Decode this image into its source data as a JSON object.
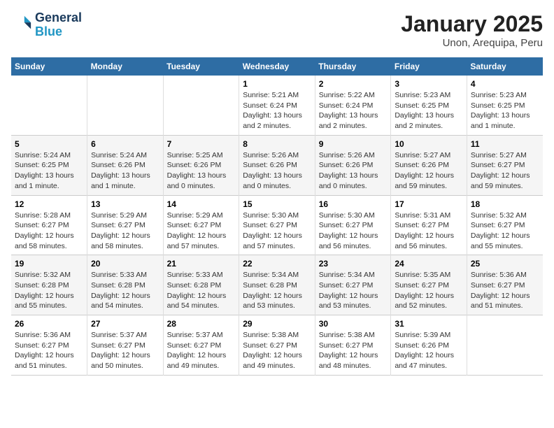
{
  "header": {
    "logo_line1": "General",
    "logo_line2": "Blue",
    "title": "January 2025",
    "subtitle": "Unon, Arequipa, Peru"
  },
  "calendar": {
    "days_of_week": [
      "Sunday",
      "Monday",
      "Tuesday",
      "Wednesday",
      "Thursday",
      "Friday",
      "Saturday"
    ],
    "weeks": [
      [
        {
          "day": "",
          "info": ""
        },
        {
          "day": "",
          "info": ""
        },
        {
          "day": "",
          "info": ""
        },
        {
          "day": "1",
          "info": "Sunrise: 5:21 AM\nSunset: 6:24 PM\nDaylight: 13 hours and 2 minutes."
        },
        {
          "day": "2",
          "info": "Sunrise: 5:22 AM\nSunset: 6:24 PM\nDaylight: 13 hours and 2 minutes."
        },
        {
          "day": "3",
          "info": "Sunrise: 5:23 AM\nSunset: 6:25 PM\nDaylight: 13 hours and 2 minutes."
        },
        {
          "day": "4",
          "info": "Sunrise: 5:23 AM\nSunset: 6:25 PM\nDaylight: 13 hours and 1 minute."
        }
      ],
      [
        {
          "day": "5",
          "info": "Sunrise: 5:24 AM\nSunset: 6:25 PM\nDaylight: 13 hours and 1 minute."
        },
        {
          "day": "6",
          "info": "Sunrise: 5:24 AM\nSunset: 6:26 PM\nDaylight: 13 hours and 1 minute."
        },
        {
          "day": "7",
          "info": "Sunrise: 5:25 AM\nSunset: 6:26 PM\nDaylight: 13 hours and 0 minutes."
        },
        {
          "day": "8",
          "info": "Sunrise: 5:26 AM\nSunset: 6:26 PM\nDaylight: 13 hours and 0 minutes."
        },
        {
          "day": "9",
          "info": "Sunrise: 5:26 AM\nSunset: 6:26 PM\nDaylight: 13 hours and 0 minutes."
        },
        {
          "day": "10",
          "info": "Sunrise: 5:27 AM\nSunset: 6:26 PM\nDaylight: 12 hours and 59 minutes."
        },
        {
          "day": "11",
          "info": "Sunrise: 5:27 AM\nSunset: 6:27 PM\nDaylight: 12 hours and 59 minutes."
        }
      ],
      [
        {
          "day": "12",
          "info": "Sunrise: 5:28 AM\nSunset: 6:27 PM\nDaylight: 12 hours and 58 minutes."
        },
        {
          "day": "13",
          "info": "Sunrise: 5:29 AM\nSunset: 6:27 PM\nDaylight: 12 hours and 58 minutes."
        },
        {
          "day": "14",
          "info": "Sunrise: 5:29 AM\nSunset: 6:27 PM\nDaylight: 12 hours and 57 minutes."
        },
        {
          "day": "15",
          "info": "Sunrise: 5:30 AM\nSunset: 6:27 PM\nDaylight: 12 hours and 57 minutes."
        },
        {
          "day": "16",
          "info": "Sunrise: 5:30 AM\nSunset: 6:27 PM\nDaylight: 12 hours and 56 minutes."
        },
        {
          "day": "17",
          "info": "Sunrise: 5:31 AM\nSunset: 6:27 PM\nDaylight: 12 hours and 56 minutes."
        },
        {
          "day": "18",
          "info": "Sunrise: 5:32 AM\nSunset: 6:27 PM\nDaylight: 12 hours and 55 minutes."
        }
      ],
      [
        {
          "day": "19",
          "info": "Sunrise: 5:32 AM\nSunset: 6:28 PM\nDaylight: 12 hours and 55 minutes."
        },
        {
          "day": "20",
          "info": "Sunrise: 5:33 AM\nSunset: 6:28 PM\nDaylight: 12 hours and 54 minutes."
        },
        {
          "day": "21",
          "info": "Sunrise: 5:33 AM\nSunset: 6:28 PM\nDaylight: 12 hours and 54 minutes."
        },
        {
          "day": "22",
          "info": "Sunrise: 5:34 AM\nSunset: 6:28 PM\nDaylight: 12 hours and 53 minutes."
        },
        {
          "day": "23",
          "info": "Sunrise: 5:34 AM\nSunset: 6:27 PM\nDaylight: 12 hours and 53 minutes."
        },
        {
          "day": "24",
          "info": "Sunrise: 5:35 AM\nSunset: 6:27 PM\nDaylight: 12 hours and 52 minutes."
        },
        {
          "day": "25",
          "info": "Sunrise: 5:36 AM\nSunset: 6:27 PM\nDaylight: 12 hours and 51 minutes."
        }
      ],
      [
        {
          "day": "26",
          "info": "Sunrise: 5:36 AM\nSunset: 6:27 PM\nDaylight: 12 hours and 51 minutes."
        },
        {
          "day": "27",
          "info": "Sunrise: 5:37 AM\nSunset: 6:27 PM\nDaylight: 12 hours and 50 minutes."
        },
        {
          "day": "28",
          "info": "Sunrise: 5:37 AM\nSunset: 6:27 PM\nDaylight: 12 hours and 49 minutes."
        },
        {
          "day": "29",
          "info": "Sunrise: 5:38 AM\nSunset: 6:27 PM\nDaylight: 12 hours and 49 minutes."
        },
        {
          "day": "30",
          "info": "Sunrise: 5:38 AM\nSunset: 6:27 PM\nDaylight: 12 hours and 48 minutes."
        },
        {
          "day": "31",
          "info": "Sunrise: 5:39 AM\nSunset: 6:26 PM\nDaylight: 12 hours and 47 minutes."
        },
        {
          "day": "",
          "info": ""
        }
      ]
    ]
  }
}
